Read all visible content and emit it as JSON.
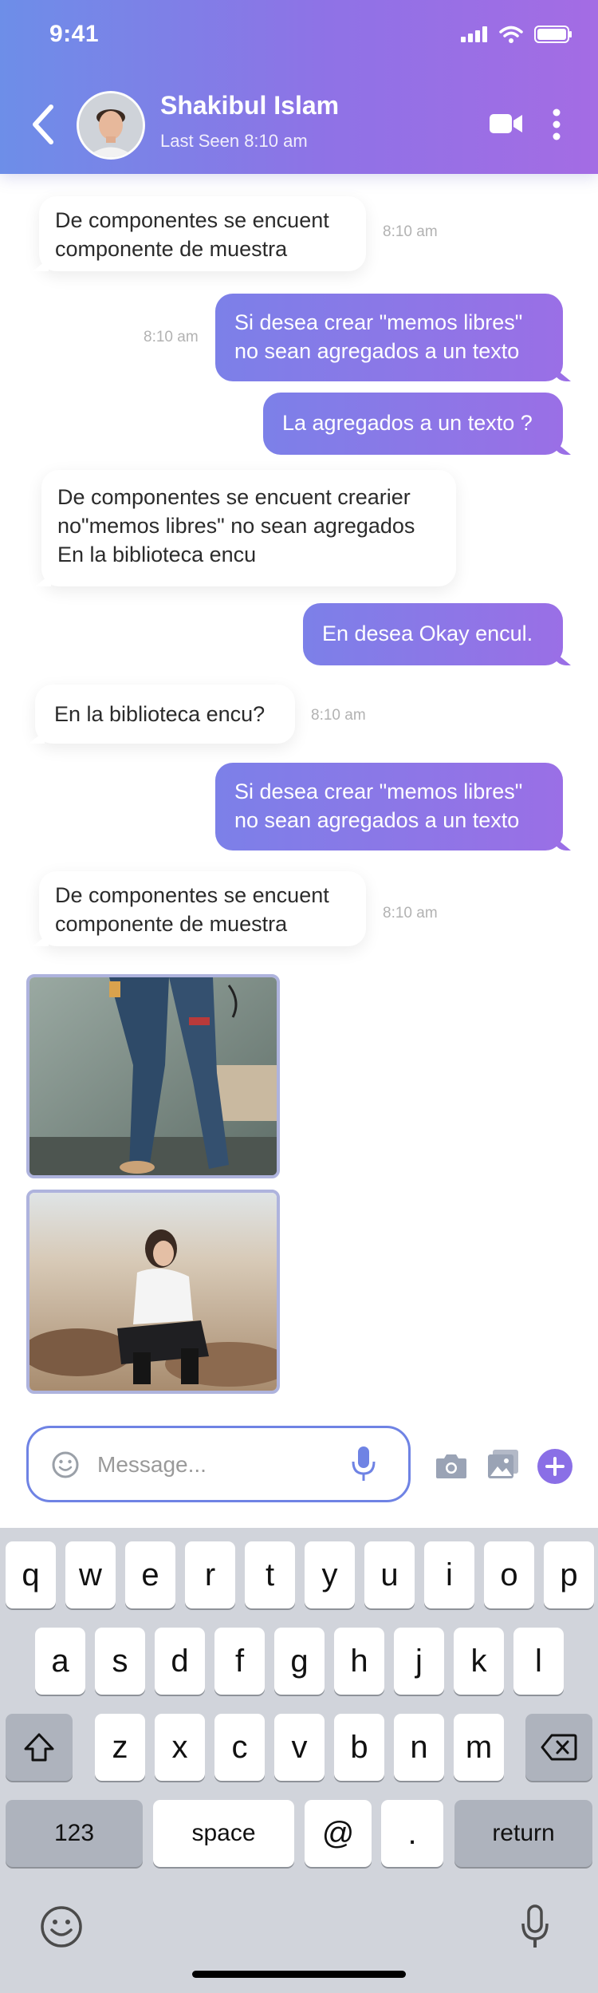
{
  "status_bar": {
    "time": "9:41"
  },
  "header": {
    "contact_name": "Shakibul Islam",
    "last_seen": "Last Seen 8:10 am",
    "icons": [
      "back-arrow-icon",
      "avatar",
      "video-call-icon",
      "more-vertical-icon"
    ]
  },
  "messages": [
    {
      "direction": "in",
      "text": "De componentes se encuent\ncomponente de muestra",
      "time": "8:10 am"
    },
    {
      "direction": "out",
      "text": "Si desea crear \"memos libres\"\nno sean agregados a un texto",
      "time": "8:10 am"
    },
    {
      "direction": "out",
      "text": "La agregados a un texto ?"
    },
    {
      "direction": "in",
      "text": "De componentes se encuent crearier\nno\"memos libres\" no sean agregados\nEn la biblioteca encu"
    },
    {
      "direction": "out",
      "text": "En desea Okay encul."
    },
    {
      "direction": "in",
      "text": "En la biblioteca encu?",
      "time": "8:10 am"
    },
    {
      "direction": "out",
      "text": "Si desea crear \"memos libres\"\nno sean agregados a un texto"
    },
    {
      "direction": "in",
      "text": "De componentes se encuent\ncomponente de muestra",
      "time": "8:10 am"
    }
  ],
  "photos": [
    "photo-jeans-legs",
    "photo-woman-sitting-desert"
  ],
  "composer": {
    "placeholder": "Message...",
    "icons": [
      "emoji-icon",
      "microphone-icon",
      "camera-icon",
      "gallery-icon",
      "plus-icon"
    ]
  },
  "keyboard": {
    "row1": [
      "q",
      "w",
      "e",
      "r",
      "t",
      "y",
      "u",
      "i",
      "o",
      "p"
    ],
    "row2": [
      "a",
      "s",
      "d",
      "f",
      "g",
      "h",
      "j",
      "k",
      "l"
    ],
    "row3": [
      "z",
      "x",
      "c",
      "v",
      "b",
      "n",
      "m"
    ],
    "numbers_key": "123",
    "space_key": "space",
    "at_key": "@",
    "dot_key": ".",
    "return_key": "return"
  },
  "colors": {
    "header_gradient_start": "#6d8ee8",
    "header_gradient_end": "#a46ce4",
    "outgoing_bubble": "#8a78e7",
    "composer_border": "#6f83e4",
    "plus_button": "#8a6fe6"
  }
}
